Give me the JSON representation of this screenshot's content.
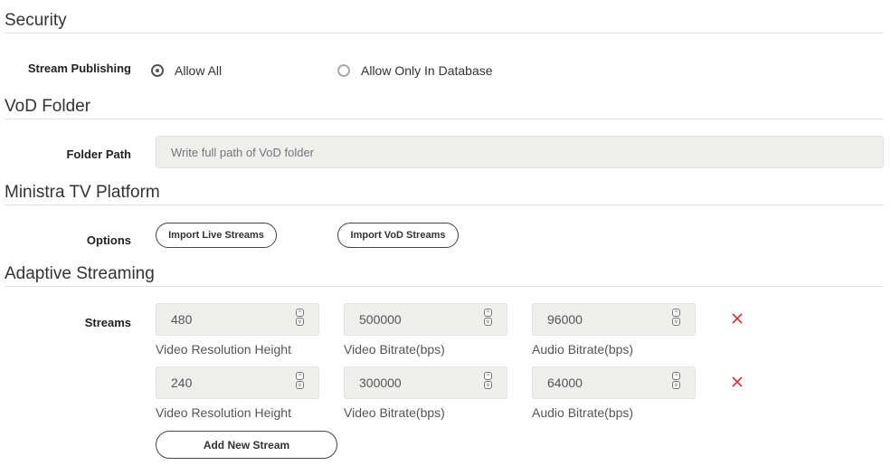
{
  "security": {
    "title": "Security",
    "stream_publishing_label": "Stream Publishing",
    "options": [
      {
        "label": "Allow All",
        "checked": true
      },
      {
        "label": "Allow Only In Database",
        "checked": false
      }
    ]
  },
  "vod": {
    "title": "VoD Folder",
    "folder_path_label": "Folder Path",
    "folder_path_placeholder": "Write full path of VoD folder",
    "folder_path_value": ""
  },
  "ministra": {
    "title": "Ministra TV Platform",
    "options_label": "Options",
    "import_live_label": "Import Live Streams",
    "import_vod_label": "Import VoD Streams"
  },
  "adaptive": {
    "title": "Adaptive Streaming",
    "streams_label": "Streams",
    "rows": [
      {
        "height": "480",
        "video_bitrate": "500000",
        "audio_bitrate": "96000"
      },
      {
        "height": "240",
        "video_bitrate": "300000",
        "audio_bitrate": "64000"
      }
    ],
    "field_labels": {
      "height": "Video Resolution Height",
      "video_bitrate": "Video Bitrate(bps)",
      "audio_bitrate": "Audio Bitrate(bps)"
    },
    "add_stream_label": "Add New Stream",
    "delete_color": "#d0323c"
  }
}
